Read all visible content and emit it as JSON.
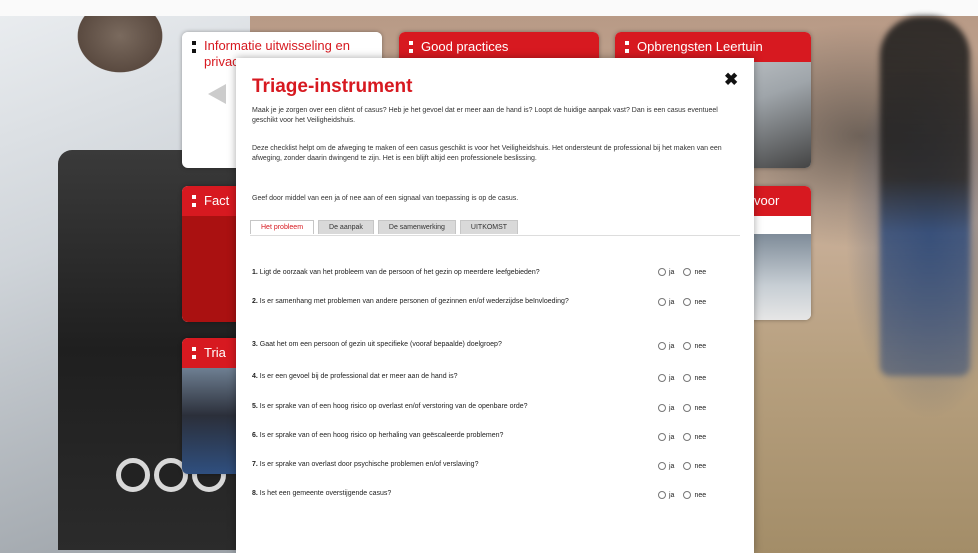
{
  "tiles": {
    "informatie": {
      "title_line1": "Informatie uitwisseling en",
      "title_line2": "privac"
    },
    "good_practices": {
      "title": "Good practices"
    },
    "opbrengsten": {
      "title": "Opbrengsten Leertuin"
    },
    "facts": {
      "title": "Fact"
    },
    "voor": {
      "title": "voor"
    },
    "triage": {
      "title": "Tria"
    }
  },
  "modal": {
    "title": "Triage-instrument",
    "close_glyph": "✖",
    "intro1": "Maak je je zorgen over een cliënt of casus? Heb je het gevoel dat er meer aan de hand is? Loopt de huidige aanpak vast? Dan is een casus eventueel geschikt voor het Veiligheidshuis.",
    "intro2": "Deze checklist helpt om de afweging te maken of een casus geschikt is voor het Veiligheidshuis. Het ondersteunt de professional bij het maken van een afweging, zonder daarin dwingend te zijn. Het is een blijft altijd een professionele beslissing.",
    "intro3": "Geef door middel van een ja of nee aan of een signaal van toepassing is op de casus.",
    "tabs": [
      "Het probleem",
      "De aanpak",
      "De samenwerking",
      "UITKOMST"
    ],
    "answer_yes": "ja",
    "answer_no": "nee",
    "questions": [
      {
        "num": "1.",
        "text": "Ligt de oorzaak van het probleem van de persoon of het gezin op meerdere leefgebieden?"
      },
      {
        "num": "2.",
        "text": "Is er samenhang met problemen van andere personen of gezinnen en/of wederzijdse beïnvloeding?"
      },
      {
        "num": "3.",
        "text": "Gaat het om een persoon of gezin uit specifieke (vooraf bepaalde) doelgroep?"
      },
      {
        "num": "4.",
        "text": "Is er een gevoel bij de professional dat er meer aan de hand is?"
      },
      {
        "num": "5.",
        "text": "Is er sprake van of een hoog risico op overlast en/of verstoring van de openbare orde?"
      },
      {
        "num": "6.",
        "text": "Is er sprake van of een hoog risico op herhaling van geëscaleerde problemen?"
      },
      {
        "num": "7.",
        "text": "Is er sprake van overlast door psychische problemen en/of verslaving?"
      },
      {
        "num": "8.",
        "text": "Is het een gemeente overstijgende casus?"
      }
    ]
  }
}
